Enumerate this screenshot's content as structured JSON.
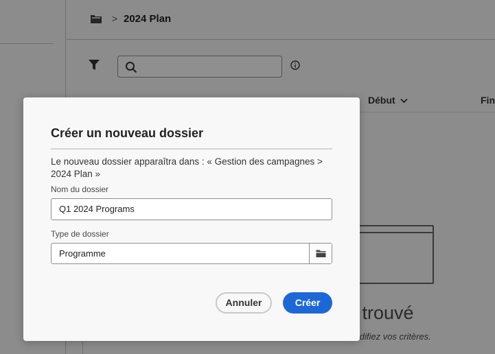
{
  "breadcrumb": {
    "icon": "folder-icon",
    "separator": ">",
    "title": "2024 Plan"
  },
  "toolbar": {
    "filter_icon": "filter-icon",
    "search": {
      "value": "",
      "icon": "search-icon"
    },
    "info_icon": "info-icon"
  },
  "table": {
    "columns": [
      "Début",
      "Fin"
    ],
    "sort_icon": "chevron-down-icon"
  },
  "empty_state": {
    "title": "ultat trouvé",
    "subtitle": "récis, modifiez vos critères."
  },
  "dialog": {
    "title": "Créer un nouveau dossier",
    "description": "Le nouveau dossier apparaîtra dans : « Gestion des campagnes > 2024 Plan »",
    "folder_name": {
      "label": "Nom du dossier",
      "value": "Q1 2024 Programs"
    },
    "folder_type": {
      "label": "Type de dossier",
      "value": "Programme",
      "browse_icon": "folder-icon"
    },
    "cancel_label": "Annuler",
    "create_label": "Créer",
    "accent_color": "#1e68d6"
  }
}
